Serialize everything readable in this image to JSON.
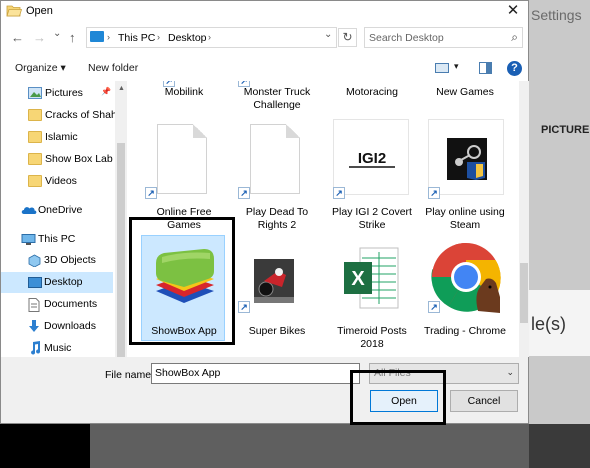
{
  "background": {
    "settings_text": "Settings",
    "pictures_text": "PICTURE",
    "files_text": "le(s)"
  },
  "dialog": {
    "title": "Open",
    "close_glyph": "✕"
  },
  "address_bar": {
    "back_glyph": "←",
    "forward_glyph": "→",
    "dropdown_glyph": "⌄",
    "up_glyph": "↑",
    "chevron_glyph": "›",
    "crumbs": [
      "This PC",
      "Desktop"
    ],
    "dropdown2_glyph": "⌄",
    "refresh_glyph": "↻",
    "search_placeholder": "Search Desktop",
    "search_glyph": "⌕"
  },
  "toolbar": {
    "organize_label": "Organize ▾",
    "new_folder_label": "New folder",
    "view_chevron": "▾",
    "help_glyph": "?"
  },
  "nav_pane": {
    "items": [
      {
        "label": "Pictures",
        "pin": "📌"
      },
      {
        "label": "Cracks of Shah"
      },
      {
        "label": "Islamic"
      },
      {
        "label": "Show Box Lab"
      },
      {
        "label": "Videos"
      },
      {
        "label": "OneDrive"
      },
      {
        "label": "This PC"
      },
      {
        "label": "3D Objects"
      },
      {
        "label": "Desktop"
      },
      {
        "label": "Documents"
      },
      {
        "label": "Downloads"
      },
      {
        "label": "Music"
      }
    ],
    "scroll_up_glyph": "▲"
  },
  "files": {
    "row0": [
      "Mobilink",
      "Monster Truck Challenge",
      "Motoracing",
      "New Games"
    ],
    "row1": [
      "Online Free Games",
      "Play Dead To Rights 2",
      "Play IGI 2 Covert Strike",
      "Play online using Steam"
    ],
    "row2": [
      "ShowBox App",
      "Super Bikes",
      "Timeroid Posts 2018",
      "Trading - Chrome"
    ],
    "shortcut_glyph": "↗",
    "igi_logo_text": "IGI2",
    "excel_letter": "X"
  },
  "footer": {
    "file_name_label": "File name:",
    "file_name_value": "ShowBox App",
    "file_type_value": "All Files",
    "file_type_chevron": "⌄",
    "open_label": "Open",
    "cancel_label": "Cancel"
  },
  "colors": {
    "accent": "#0078d7",
    "selection": "#cce8ff",
    "folder": "#f7d675"
  }
}
